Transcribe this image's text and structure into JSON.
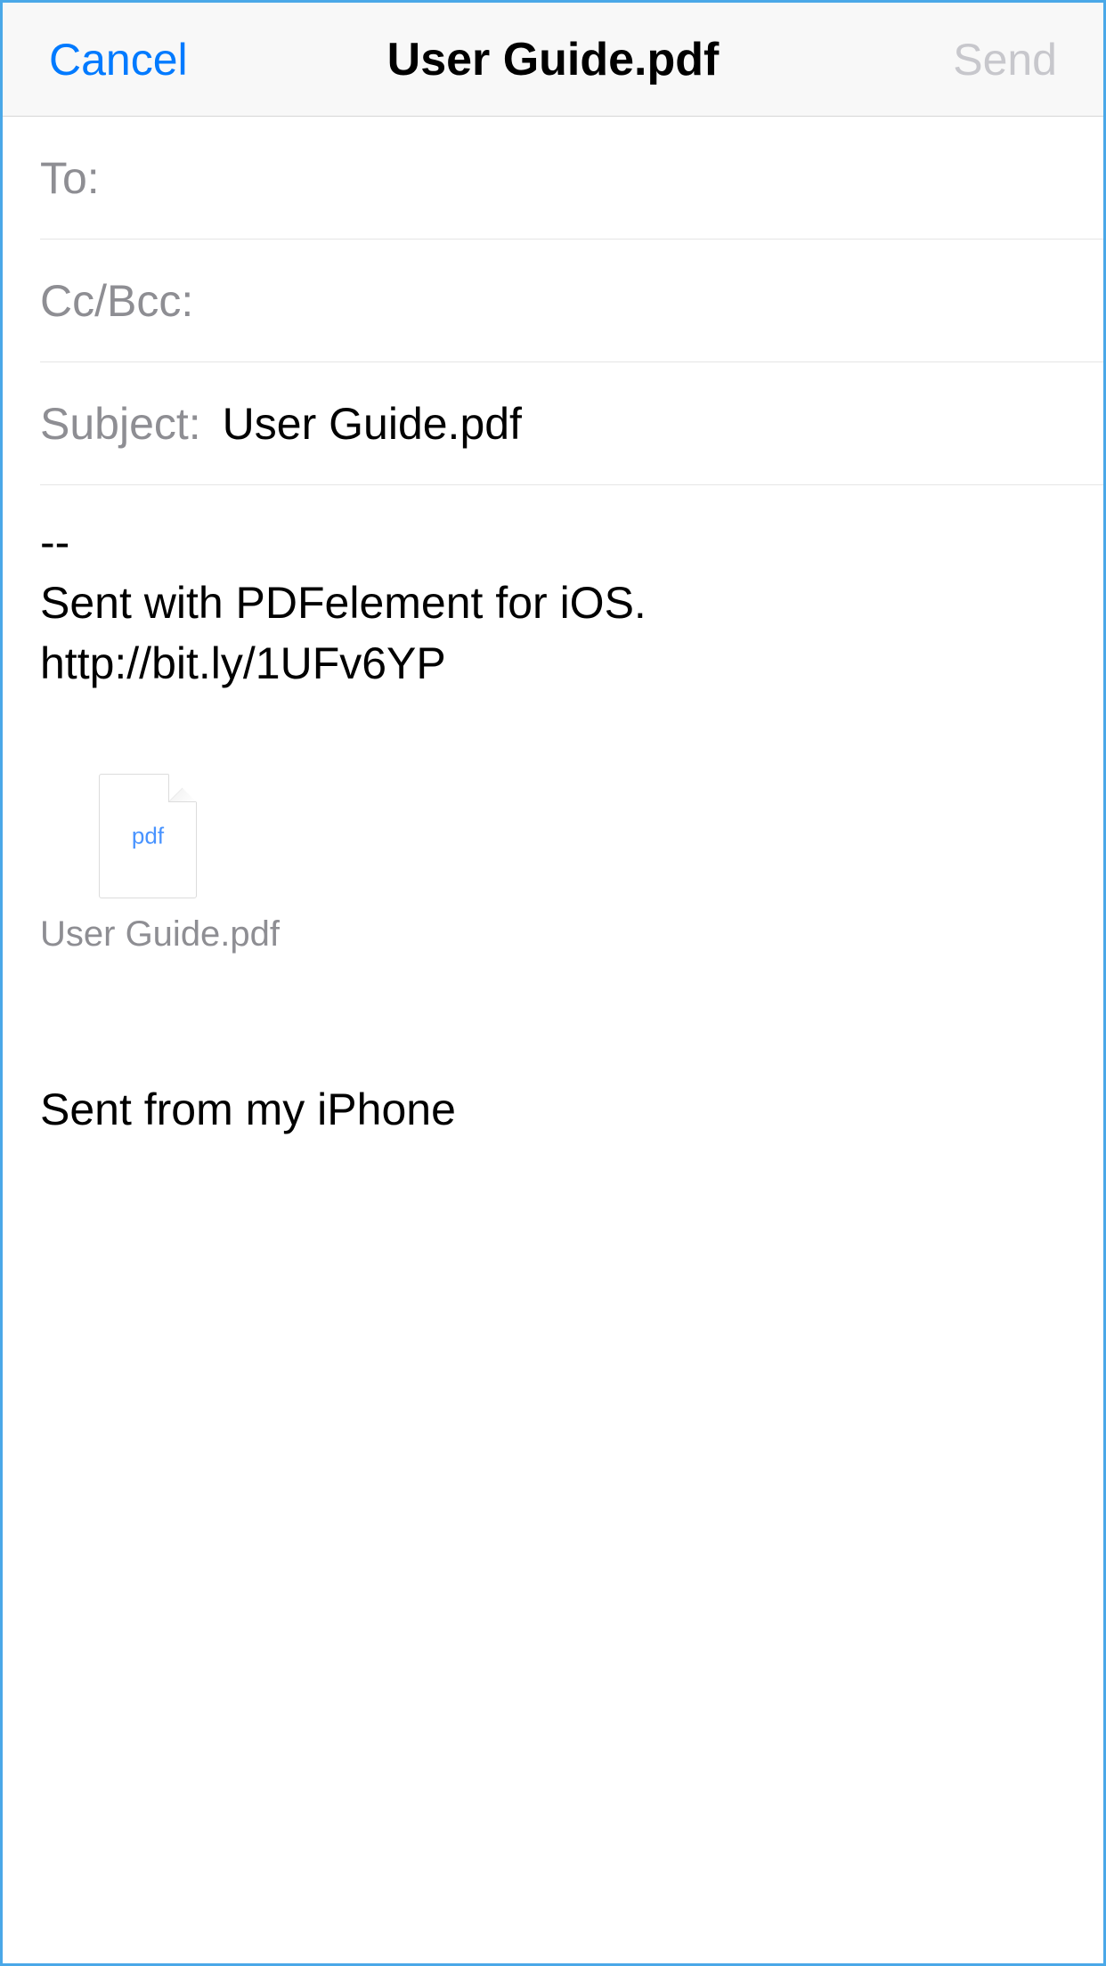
{
  "navbar": {
    "cancel": "Cancel",
    "title": "User Guide.pdf",
    "send": "Send"
  },
  "fields": {
    "to_label": "To:",
    "to_value": "",
    "ccbcc_label": "Cc/Bcc:",
    "ccbcc_value": "",
    "subject_label": "Subject:",
    "subject_value": "User Guide.pdf"
  },
  "body": {
    "text": "--\nSent with PDFelement for iOS.\nhttp://bit.ly/1UFv6YP"
  },
  "attachment": {
    "type_label": "pdf",
    "filename": "User Guide.pdf"
  },
  "signature": "Sent from my iPhone"
}
